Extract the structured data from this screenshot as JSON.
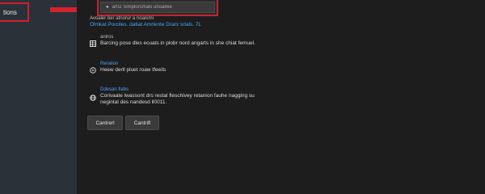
{
  "sidebar": {
    "items": [
      {
        "label": "tions"
      }
    ]
  },
  "search": {
    "value": "ar02 Simplorsmals unoaifee"
  },
  "settings": [
    {
      "title": "Avoaler ber atnorur a noanimi",
      "body": "Olmkat Porciles. datiat Amrlente Drarx srlals. 7L",
      "body_link": true,
      "icon": ""
    },
    {
      "title": "aniros",
      "body": "Barcing pose dles ecuats in plobr nord angarts in she chiat femuel.",
      "icon": "grid-icon"
    },
    {
      "title": "Reraiion",
      "title_link": true,
      "body": "Heew derll pluet roaw tfeeils",
      "icon": "link-icon"
    },
    {
      "title": "Ddesan fiabs",
      "title_link": true,
      "body": "Corivaate lwassont drs restal fleschivey retanion fauhe nagging su negintal des nandesd ll0011.",
      "icon": "globe-icon"
    }
  ],
  "buttons": {
    "primary_label": "Cantrerl",
    "secondary_label": "Cantrifl"
  },
  "colors": {
    "highlight": "#d02030",
    "link": "#4ea1f3"
  }
}
